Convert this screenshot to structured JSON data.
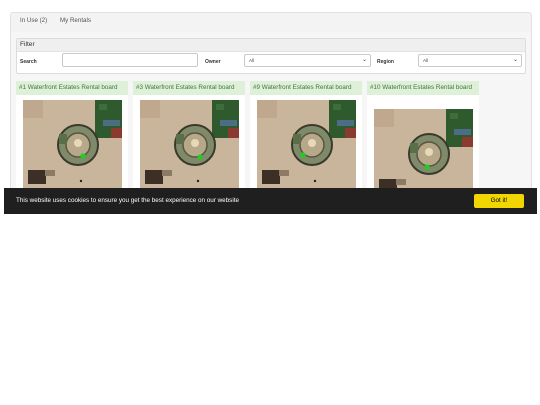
{
  "tabs": [
    {
      "label": "In Use (2)"
    },
    {
      "label": "My Rentals"
    }
  ],
  "filter": {
    "title": "Filter",
    "search_label": "Search",
    "search_value": "",
    "owner_label": "Owner",
    "owner_value": "All",
    "region_label": "Region",
    "region_value": "All"
  },
  "cards": [
    {
      "title": "#1 Waterfront Estates Rental board"
    },
    {
      "title": "#3 Waterfront Estates Rental board"
    },
    {
      "title": "#9 Waterfront Estates Rental board"
    },
    {
      "title": "#10 Waterfront Estates Rental board"
    }
  ],
  "cookie": {
    "message": "This website uses cookies to ensure you get the best experience on our website",
    "button": "Got it!"
  },
  "colors": {
    "card_title_bg": "#dff0d8",
    "card_title_text": "#3c763d",
    "cookie_bg": "#1f1f1f",
    "cookie_button": "#f1d600"
  }
}
